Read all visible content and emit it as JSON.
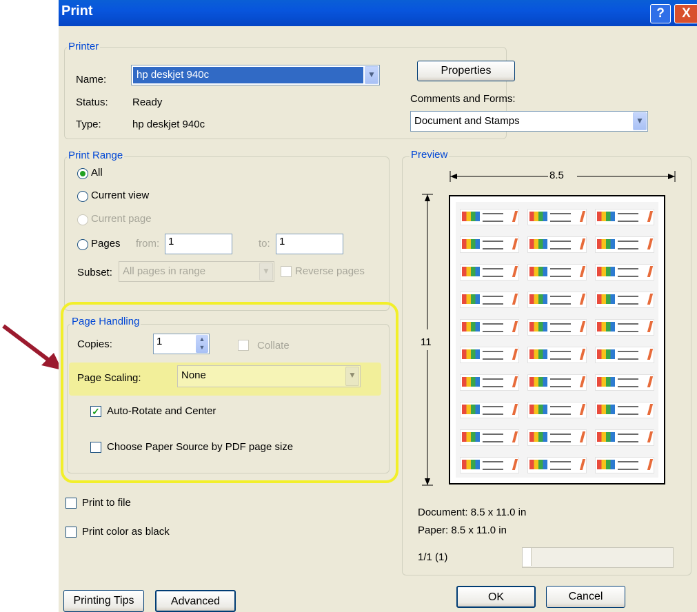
{
  "window": {
    "title": "Print",
    "help_glyph": "?",
    "close_glyph": "X"
  },
  "printer": {
    "legend": "Printer",
    "name_label": "Name:",
    "name_value": "hp deskjet 940c",
    "status_label": "Status:",
    "status_value": "Ready",
    "type_label": "Type:",
    "type_value": "hp deskjet 940c",
    "properties_button": "Properties",
    "comments_label": "Comments and Forms:",
    "comments_value": "Document and Stamps"
  },
  "print_range": {
    "legend": "Print Range",
    "all": "All",
    "current_view": "Current view",
    "current_page": "Current page",
    "pages": "Pages",
    "from_label": "from:",
    "from_value": "1",
    "to_label": "to:",
    "to_value": "1",
    "subset_label": "Subset:",
    "subset_value": "All pages in range",
    "reverse_pages": "Reverse pages",
    "selected": "all"
  },
  "page_handling": {
    "legend": "Page Handling",
    "copies_label": "Copies:",
    "copies_value": "1",
    "collate_label": "Collate",
    "scaling_label": "Page Scaling:",
    "scaling_value": "None",
    "auto_rotate_label": "Auto-Rotate and Center",
    "auto_rotate_checked": true,
    "paper_source_label": "Choose Paper Source by PDF page size",
    "paper_source_checked": false,
    "highlight_color": "#f2ef2a"
  },
  "options": {
    "print_to_file": "Print to file",
    "print_color_as_black": "Print color as black"
  },
  "preview": {
    "legend": "Preview",
    "width_label": "8.5",
    "height_label": "11",
    "document_info": "Document: 8.5 x 11.0 in",
    "paper_info": "Paper: 8.5 x 11.0 in",
    "page_counter": "1/1 (1)",
    "label_rows": 10,
    "label_cols": 3
  },
  "buttons": {
    "printing_tips": "Printing Tips",
    "advanced": "Advanced",
    "ok": "OK",
    "cancel": "Cancel"
  },
  "annotation": {
    "arrow_color": "#9b1a2e"
  }
}
